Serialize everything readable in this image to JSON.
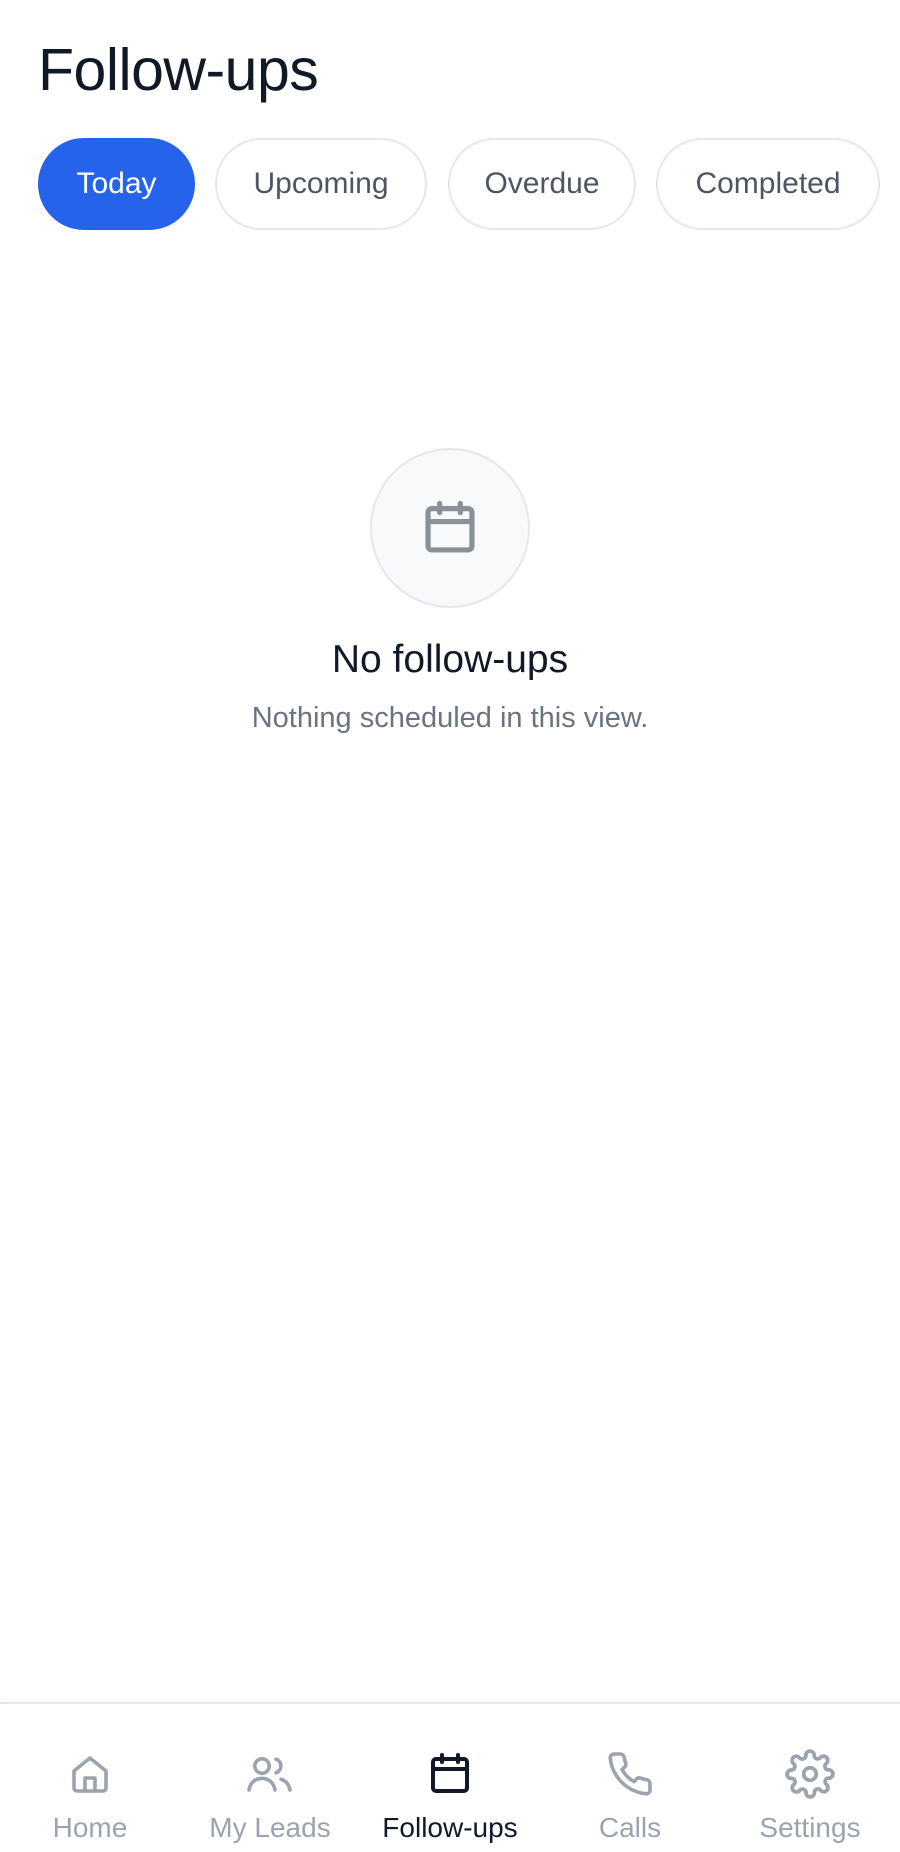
{
  "header": {
    "title": "Follow-ups"
  },
  "tabs": [
    {
      "label": "Today",
      "active": true
    },
    {
      "label": "Upcoming",
      "active": false
    },
    {
      "label": "Overdue",
      "active": false
    },
    {
      "label": "Completed",
      "active": false
    }
  ],
  "empty_state": {
    "icon": "calendar-icon",
    "title": "No follow-ups",
    "subtitle": "Nothing scheduled in this view."
  },
  "bottom_nav": [
    {
      "label": "Home",
      "icon": "home-icon",
      "active": false
    },
    {
      "label": "My Leads",
      "icon": "users-icon",
      "active": false
    },
    {
      "label": "Follow-ups",
      "icon": "calendar-icon",
      "active": true
    },
    {
      "label": "Calls",
      "icon": "phone-icon",
      "active": false
    },
    {
      "label": "Settings",
      "icon": "gear-icon",
      "active": false
    }
  ],
  "colors": {
    "accent": "#2563eb",
    "text_primary": "#111827",
    "text_secondary": "#6b7280",
    "nav_inactive": "#9ca3af",
    "border": "#e5e7eb"
  }
}
